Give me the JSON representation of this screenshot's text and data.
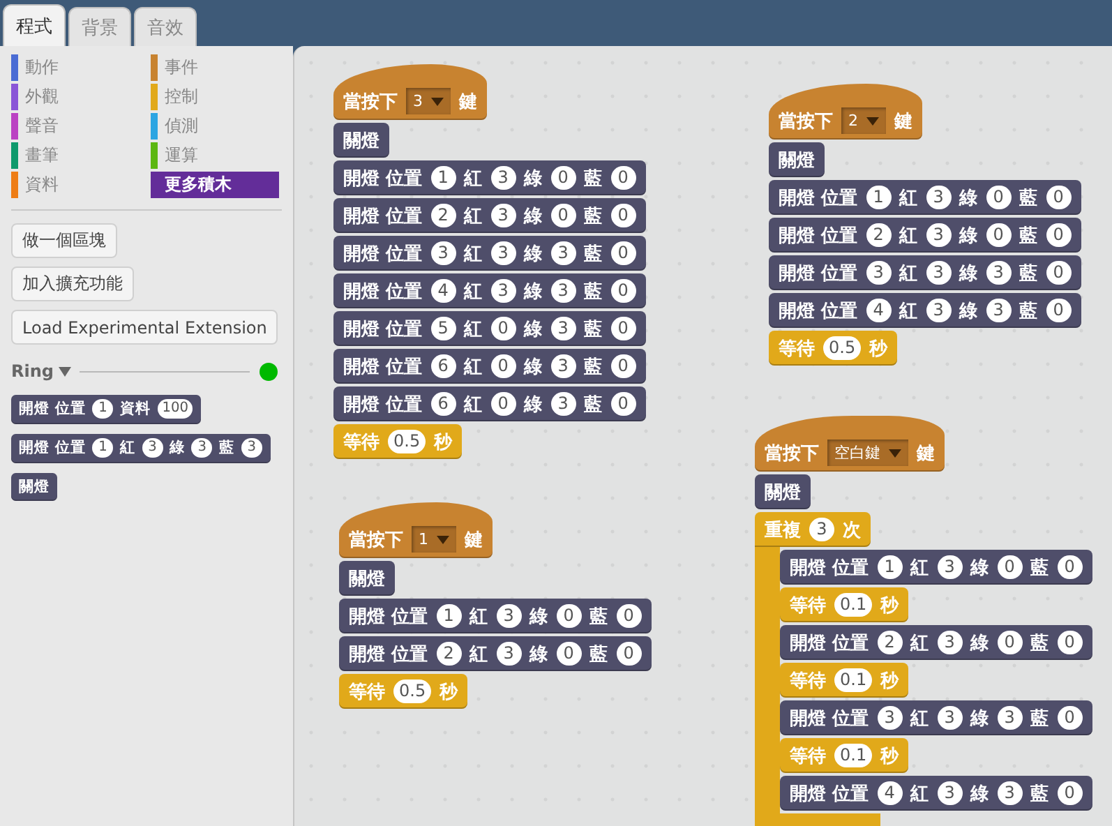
{
  "tabs": [
    {
      "label": "程式",
      "selected": true
    },
    {
      "label": "背景",
      "selected": false
    },
    {
      "label": "音效",
      "selected": false
    }
  ],
  "categories": [
    {
      "label": "動作",
      "color": "#4a6cd4",
      "selected": false
    },
    {
      "label": "事件",
      "color": "#c88330",
      "selected": false
    },
    {
      "label": "外觀",
      "color": "#8a55d7",
      "selected": false
    },
    {
      "label": "控制",
      "color": "#e1a91a",
      "selected": false
    },
    {
      "label": "聲音",
      "color": "#bb42c3",
      "selected": false
    },
    {
      "label": "偵測",
      "color": "#2ca5e2",
      "selected": false
    },
    {
      "label": "畫筆",
      "color": "#0e9a6c",
      "selected": false
    },
    {
      "label": "運算",
      "color": "#5cb712",
      "selected": false
    },
    {
      "label": "資料",
      "color": "#ee7d16",
      "selected": false
    },
    {
      "label": "更多積木",
      "color": "#632d99",
      "selected": true
    }
  ],
  "buttons": [
    "做一個區塊",
    "加入擴充功能",
    "Load Experimental Extension"
  ],
  "extension": {
    "name": "Ring",
    "connected": true
  },
  "palette_blocks": [
    {
      "kind": "command",
      "parts": [
        {
          "kind": "label",
          "text": "開燈 位置"
        },
        {
          "kind": "number",
          "text": "1"
        },
        {
          "kind": "label",
          "text": "資料"
        },
        {
          "kind": "number",
          "text": "100"
        }
      ]
    },
    {
      "kind": "command",
      "parts": [
        {
          "kind": "label",
          "text": "開燈 位置"
        },
        {
          "kind": "number",
          "text": "1"
        },
        {
          "kind": "label",
          "text": "紅"
        },
        {
          "kind": "number",
          "text": "3"
        },
        {
          "kind": "label",
          "text": "綠"
        },
        {
          "kind": "number",
          "text": "3"
        },
        {
          "kind": "label",
          "text": "藍"
        },
        {
          "kind": "number",
          "text": "3"
        }
      ]
    },
    {
      "kind": "command",
      "parts": [
        {
          "kind": "label",
          "text": "關燈"
        }
      ]
    }
  ],
  "scripts": [
    {
      "blocks": [
        {
          "kind": "hat",
          "parts": [
            {
              "kind": "label",
              "text": "當按下"
            },
            {
              "kind": "dropdown",
              "text": "3"
            },
            {
              "kind": "label",
              "text": "鍵"
            }
          ]
        },
        {
          "kind": "command",
          "parts": [
            {
              "kind": "label",
              "text": "關燈"
            }
          ]
        },
        {
          "kind": "command",
          "parts": [
            {
              "kind": "label",
              "text": "開燈 位置"
            },
            {
              "kind": "number",
              "text": "1"
            },
            {
              "kind": "label",
              "text": "紅"
            },
            {
              "kind": "number",
              "text": "3"
            },
            {
              "kind": "label",
              "text": "綠"
            },
            {
              "kind": "number",
              "text": "0"
            },
            {
              "kind": "label",
              "text": "藍"
            },
            {
              "kind": "number",
              "text": "0"
            }
          ]
        },
        {
          "kind": "command",
          "parts": [
            {
              "kind": "label",
              "text": "開燈 位置"
            },
            {
              "kind": "number",
              "text": "2"
            },
            {
              "kind": "label",
              "text": "紅"
            },
            {
              "kind": "number",
              "text": "3"
            },
            {
              "kind": "label",
              "text": "綠"
            },
            {
              "kind": "number",
              "text": "0"
            },
            {
              "kind": "label",
              "text": "藍"
            },
            {
              "kind": "number",
              "text": "0"
            }
          ]
        },
        {
          "kind": "command",
          "parts": [
            {
              "kind": "label",
              "text": "開燈 位置"
            },
            {
              "kind": "number",
              "text": "3"
            },
            {
              "kind": "label",
              "text": "紅"
            },
            {
              "kind": "number",
              "text": "3"
            },
            {
              "kind": "label",
              "text": "綠"
            },
            {
              "kind": "number",
              "text": "3"
            },
            {
              "kind": "label",
              "text": "藍"
            },
            {
              "kind": "number",
              "text": "0"
            }
          ]
        },
        {
          "kind": "command",
          "parts": [
            {
              "kind": "label",
              "text": "開燈 位置"
            },
            {
              "kind": "number",
              "text": "4"
            },
            {
              "kind": "label",
              "text": "紅"
            },
            {
              "kind": "number",
              "text": "3"
            },
            {
              "kind": "label",
              "text": "綠"
            },
            {
              "kind": "number",
              "text": "3"
            },
            {
              "kind": "label",
              "text": "藍"
            },
            {
              "kind": "number",
              "text": "0"
            }
          ]
        },
        {
          "kind": "command",
          "parts": [
            {
              "kind": "label",
              "text": "開燈 位置"
            },
            {
              "kind": "number",
              "text": "5"
            },
            {
              "kind": "label",
              "text": "紅"
            },
            {
              "kind": "number",
              "text": "0"
            },
            {
              "kind": "label",
              "text": "綠"
            },
            {
              "kind": "number",
              "text": "3"
            },
            {
              "kind": "label",
              "text": "藍"
            },
            {
              "kind": "number",
              "text": "0"
            }
          ]
        },
        {
          "kind": "command",
          "parts": [
            {
              "kind": "label",
              "text": "開燈 位置"
            },
            {
              "kind": "number",
              "text": "6"
            },
            {
              "kind": "label",
              "text": "紅"
            },
            {
              "kind": "number",
              "text": "0"
            },
            {
              "kind": "label",
              "text": "綠"
            },
            {
              "kind": "number",
              "text": "3"
            },
            {
              "kind": "label",
              "text": "藍"
            },
            {
              "kind": "number",
              "text": "0"
            }
          ]
        },
        {
          "kind": "command",
          "parts": [
            {
              "kind": "label",
              "text": "開燈 位置"
            },
            {
              "kind": "number",
              "text": "6"
            },
            {
              "kind": "label",
              "text": "紅"
            },
            {
              "kind": "number",
              "text": "0"
            },
            {
              "kind": "label",
              "text": "綠"
            },
            {
              "kind": "number",
              "text": "3"
            },
            {
              "kind": "label",
              "text": "藍"
            },
            {
              "kind": "number",
              "text": "0"
            }
          ]
        },
        {
          "kind": "wait",
          "parts": [
            {
              "kind": "label",
              "text": "等待"
            },
            {
              "kind": "number",
              "text": "0.5"
            },
            {
              "kind": "label",
              "text": "秒"
            }
          ]
        }
      ]
    },
    {
      "blocks": [
        {
          "kind": "hat",
          "parts": [
            {
              "kind": "label",
              "text": "當按下"
            },
            {
              "kind": "dropdown",
              "text": "2"
            },
            {
              "kind": "label",
              "text": "鍵"
            }
          ]
        },
        {
          "kind": "command",
          "parts": [
            {
              "kind": "label",
              "text": "關燈"
            }
          ]
        },
        {
          "kind": "command",
          "parts": [
            {
              "kind": "label",
              "text": "開燈 位置"
            },
            {
              "kind": "number",
              "text": "1"
            },
            {
              "kind": "label",
              "text": "紅"
            },
            {
              "kind": "number",
              "text": "3"
            },
            {
              "kind": "label",
              "text": "綠"
            },
            {
              "kind": "number",
              "text": "0"
            },
            {
              "kind": "label",
              "text": "藍"
            },
            {
              "kind": "number",
              "text": "0"
            }
          ]
        },
        {
          "kind": "command",
          "parts": [
            {
              "kind": "label",
              "text": "開燈 位置"
            },
            {
              "kind": "number",
              "text": "2"
            },
            {
              "kind": "label",
              "text": "紅"
            },
            {
              "kind": "number",
              "text": "3"
            },
            {
              "kind": "label",
              "text": "綠"
            },
            {
              "kind": "number",
              "text": "0"
            },
            {
              "kind": "label",
              "text": "藍"
            },
            {
              "kind": "number",
              "text": "0"
            }
          ]
        },
        {
          "kind": "command",
          "parts": [
            {
              "kind": "label",
              "text": "開燈 位置"
            },
            {
              "kind": "number",
              "text": "3"
            },
            {
              "kind": "label",
              "text": "紅"
            },
            {
              "kind": "number",
              "text": "3"
            },
            {
              "kind": "label",
              "text": "綠"
            },
            {
              "kind": "number",
              "text": "3"
            },
            {
              "kind": "label",
              "text": "藍"
            },
            {
              "kind": "number",
              "text": "0"
            }
          ]
        },
        {
          "kind": "command",
          "parts": [
            {
              "kind": "label",
              "text": "開燈 位置"
            },
            {
              "kind": "number",
              "text": "4"
            },
            {
              "kind": "label",
              "text": "紅"
            },
            {
              "kind": "number",
              "text": "3"
            },
            {
              "kind": "label",
              "text": "綠"
            },
            {
              "kind": "number",
              "text": "3"
            },
            {
              "kind": "label",
              "text": "藍"
            },
            {
              "kind": "number",
              "text": "0"
            }
          ]
        },
        {
          "kind": "wait",
          "parts": [
            {
              "kind": "label",
              "text": "等待"
            },
            {
              "kind": "number",
              "text": "0.5"
            },
            {
              "kind": "label",
              "text": "秒"
            }
          ]
        }
      ]
    },
    {
      "blocks": [
        {
          "kind": "hat",
          "parts": [
            {
              "kind": "label",
              "text": "當按下"
            },
            {
              "kind": "dropdown",
              "text": "1"
            },
            {
              "kind": "label",
              "text": "鍵"
            }
          ]
        },
        {
          "kind": "command",
          "parts": [
            {
              "kind": "label",
              "text": "關燈"
            }
          ]
        },
        {
          "kind": "command",
          "parts": [
            {
              "kind": "label",
              "text": "開燈 位置"
            },
            {
              "kind": "number",
              "text": "1"
            },
            {
              "kind": "label",
              "text": "紅"
            },
            {
              "kind": "number",
              "text": "3"
            },
            {
              "kind": "label",
              "text": "綠"
            },
            {
              "kind": "number",
              "text": "0"
            },
            {
              "kind": "label",
              "text": "藍"
            },
            {
              "kind": "number",
              "text": "0"
            }
          ]
        },
        {
          "kind": "command",
          "parts": [
            {
              "kind": "label",
              "text": "開燈 位置"
            },
            {
              "kind": "number",
              "text": "2"
            },
            {
              "kind": "label",
              "text": "紅"
            },
            {
              "kind": "number",
              "text": "3"
            },
            {
              "kind": "label",
              "text": "綠"
            },
            {
              "kind": "number",
              "text": "0"
            },
            {
              "kind": "label",
              "text": "藍"
            },
            {
              "kind": "number",
              "text": "0"
            }
          ]
        },
        {
          "kind": "wait",
          "parts": [
            {
              "kind": "label",
              "text": "等待"
            },
            {
              "kind": "number",
              "text": "0.5"
            },
            {
              "kind": "label",
              "text": "秒"
            }
          ]
        }
      ]
    },
    {
      "blocks": [
        {
          "kind": "hat",
          "parts": [
            {
              "kind": "label",
              "text": "當按下"
            },
            {
              "kind": "dropdown",
              "text": "空白鍵"
            },
            {
              "kind": "label",
              "text": "鍵"
            }
          ]
        },
        {
          "kind": "command",
          "parts": [
            {
              "kind": "label",
              "text": "關燈"
            }
          ]
        },
        {
          "kind": "repeat",
          "parts": [
            {
              "kind": "label",
              "text": "重複"
            },
            {
              "kind": "number",
              "text": "3"
            },
            {
              "kind": "label",
              "text": "次"
            }
          ],
          "children": [
            {
              "kind": "command",
              "parts": [
                {
                  "kind": "label",
                  "text": "開燈 位置"
                },
                {
                  "kind": "number",
                  "text": "1"
                },
                {
                  "kind": "label",
                  "text": "紅"
                },
                {
                  "kind": "number",
                  "text": "3"
                },
                {
                  "kind": "label",
                  "text": "綠"
                },
                {
                  "kind": "number",
                  "text": "0"
                },
                {
                  "kind": "label",
                  "text": "藍"
                },
                {
                  "kind": "number",
                  "text": "0"
                }
              ]
            },
            {
              "kind": "wait",
              "parts": [
                {
                  "kind": "label",
                  "text": "等待"
                },
                {
                  "kind": "number",
                  "text": "0.1"
                },
                {
                  "kind": "label",
                  "text": "秒"
                }
              ]
            },
            {
              "kind": "command",
              "parts": [
                {
                  "kind": "label",
                  "text": "開燈 位置"
                },
                {
                  "kind": "number",
                  "text": "2"
                },
                {
                  "kind": "label",
                  "text": "紅"
                },
                {
                  "kind": "number",
                  "text": "3"
                },
                {
                  "kind": "label",
                  "text": "綠"
                },
                {
                  "kind": "number",
                  "text": "0"
                },
                {
                  "kind": "label",
                  "text": "藍"
                },
                {
                  "kind": "number",
                  "text": "0"
                }
              ]
            },
            {
              "kind": "wait",
              "parts": [
                {
                  "kind": "label",
                  "text": "等待"
                },
                {
                  "kind": "number",
                  "text": "0.1"
                },
                {
                  "kind": "label",
                  "text": "秒"
                }
              ]
            },
            {
              "kind": "command",
              "parts": [
                {
                  "kind": "label",
                  "text": "開燈 位置"
                },
                {
                  "kind": "number",
                  "text": "3"
                },
                {
                  "kind": "label",
                  "text": "紅"
                },
                {
                  "kind": "number",
                  "text": "3"
                },
                {
                  "kind": "label",
                  "text": "綠"
                },
                {
                  "kind": "number",
                  "text": "3"
                },
                {
                  "kind": "label",
                  "text": "藍"
                },
                {
                  "kind": "number",
                  "text": "0"
                }
              ]
            },
            {
              "kind": "wait",
              "parts": [
                {
                  "kind": "label",
                  "text": "等待"
                },
                {
                  "kind": "number",
                  "text": "0.1"
                },
                {
                  "kind": "label",
                  "text": "秒"
                }
              ]
            },
            {
              "kind": "command",
              "parts": [
                {
                  "kind": "label",
                  "text": "開燈 位置"
                },
                {
                  "kind": "number",
                  "text": "4"
                },
                {
                  "kind": "label",
                  "text": "紅"
                },
                {
                  "kind": "number",
                  "text": "3"
                },
                {
                  "kind": "label",
                  "text": "綠"
                },
                {
                  "kind": "number",
                  "text": "3"
                },
                {
                  "kind": "label",
                  "text": "藍"
                },
                {
                  "kind": "number",
                  "text": "0"
                }
              ]
            }
          ]
        }
      ]
    }
  ]
}
